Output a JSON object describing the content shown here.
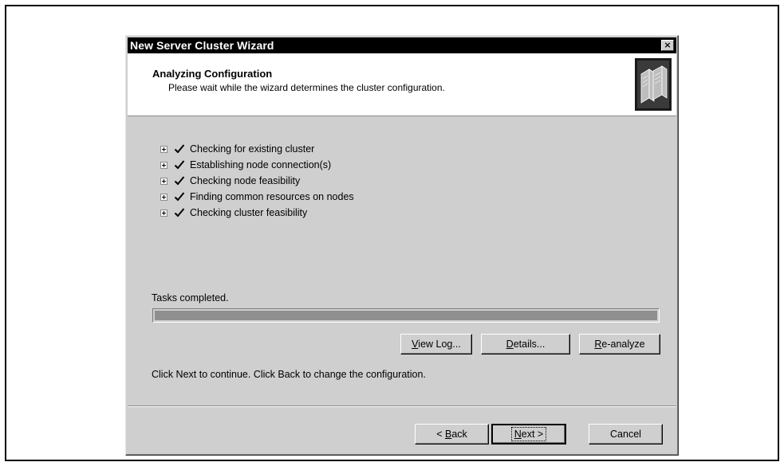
{
  "window": {
    "title": "New Server Cluster Wizard",
    "close_label": "×"
  },
  "header": {
    "title": "Analyzing Configuration",
    "subtitle": "Please wait while the wizard determines the cluster configuration.",
    "icon": "server-cluster-icon"
  },
  "tasks": [
    {
      "label": "Checking for existing cluster",
      "status": "completed"
    },
    {
      "label": "Establishing node connection(s)",
      "status": "completed"
    },
    {
      "label": "Checking node feasibility",
      "status": "completed"
    },
    {
      "label": "Finding common resources on nodes",
      "status": "completed"
    },
    {
      "label": "Checking cluster feasibility",
      "status": "completed"
    }
  ],
  "progress": {
    "status_text": "Tasks completed.",
    "value": 1.0
  },
  "action_buttons": {
    "view_log": {
      "mnemonic": "V",
      "rest": "iew Log..."
    },
    "details": {
      "mnemonic": "D",
      "rest": "etails..."
    },
    "reanalyze": {
      "mnemonic": "R",
      "rest": "e-analyze"
    }
  },
  "info_text": "Click Next to continue. Click Back to change the configuration.",
  "footer": {
    "back": {
      "prefix": "< ",
      "mnemonic": "B",
      "rest": "ack"
    },
    "next": {
      "mnemonic": "N",
      "rest": "ext >"
    },
    "cancel": "Cancel"
  },
  "colors": {
    "titlebar": "#000000",
    "dialog_face": "#cfcfcf",
    "progress_fill": "#8f8f8f"
  }
}
